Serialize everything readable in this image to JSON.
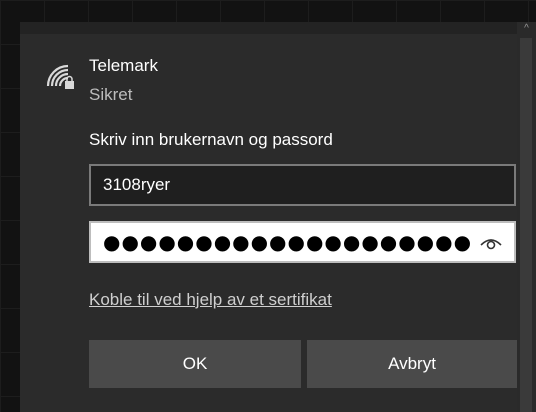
{
  "network": {
    "name": "Telemark",
    "status": "Sikret",
    "icon": "wifi-secured-icon"
  },
  "form": {
    "prompt": "Skriv inn brukernavn og passord",
    "username_value": "3108ryer",
    "password_masked": "●●●●●●●●●●●●●●●●●●●●",
    "reveal_icon": "eye-icon"
  },
  "link": {
    "certificate_label": "Koble til ved hjelp av et sertifikat"
  },
  "buttons": {
    "ok_label": "OK",
    "cancel_label": "Avbryt"
  },
  "colors": {
    "panel_bg": "#2b2b2b",
    "button_bg": "#4a4a4a",
    "text": "#ffffff"
  }
}
